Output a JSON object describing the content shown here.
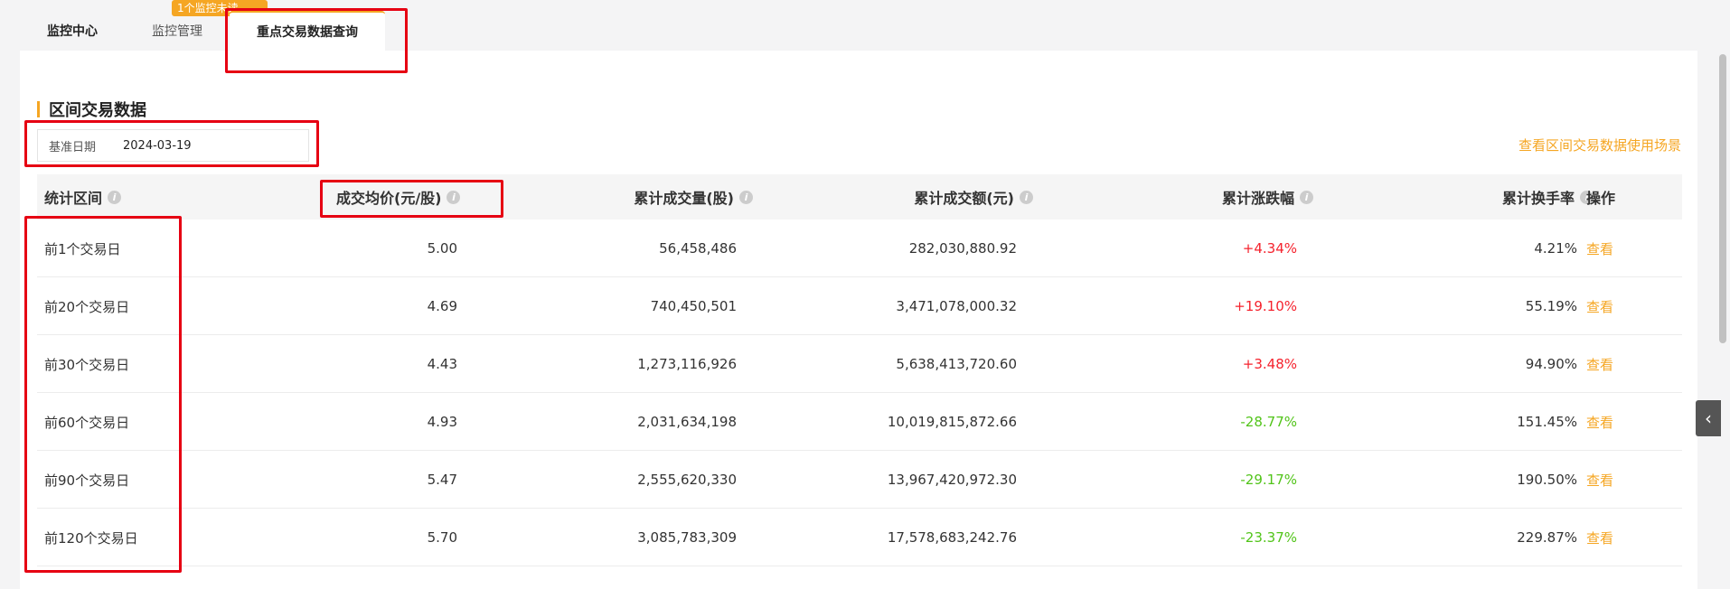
{
  "tabs": [
    {
      "label": "监控中心"
    },
    {
      "label": "监控管理"
    },
    {
      "label": "重点交易数据查询"
    }
  ],
  "tab_tip": "1个监控未读",
  "section": {
    "title": "区间交易数据",
    "date_label": "基准日期",
    "date_value": "2024-03-19",
    "scene_link": "查看区间交易数据使用场景"
  },
  "table": {
    "headers": [
      "统计区间",
      "成交均价(元/股)",
      "累计成交量(股)",
      "累计成交额(元)",
      "累计涨跌幅",
      "累计换手率",
      "操作"
    ],
    "rows": [
      {
        "period": "前1个交易日",
        "avg_price": "5.00",
        "volume": "56,458,486",
        "amount": "282,030,880.92",
        "change": "+4.34%",
        "turnover": "4.21%",
        "action": "查看"
      },
      {
        "period": "前20个交易日",
        "avg_price": "4.69",
        "volume": "740,450,501",
        "amount": "3,471,078,000.32",
        "change": "+19.10%",
        "turnover": "55.19%",
        "action": "查看"
      },
      {
        "period": "前30个交易日",
        "avg_price": "4.43",
        "volume": "1,273,116,926",
        "amount": "5,638,413,720.60",
        "change": "+3.48%",
        "turnover": "94.90%",
        "action": "查看"
      },
      {
        "period": "前60个交易日",
        "avg_price": "4.93",
        "volume": "2,031,634,198",
        "amount": "10,019,815,872.66",
        "change": "-28.77%",
        "turnover": "151.45%",
        "action": "查看"
      },
      {
        "period": "前90个交易日",
        "avg_price": "5.47",
        "volume": "2,555,620,330",
        "amount": "13,967,420,972.30",
        "change": "-29.17%",
        "turnover": "190.50%",
        "action": "查看"
      },
      {
        "period": "前120个交易日",
        "avg_price": "5.70",
        "volume": "3,085,783,309",
        "amount": "17,578,683,242.76",
        "change": "-23.37%",
        "turnover": "229.87%",
        "action": "查看"
      }
    ]
  },
  "colors": {
    "accent": "#f5a623",
    "up": "#f5222d",
    "down": "#52c41a",
    "annotation": "#e60012"
  },
  "icons": {
    "info": "info-circle-icon",
    "collapse": "chevron-left-icon"
  }
}
